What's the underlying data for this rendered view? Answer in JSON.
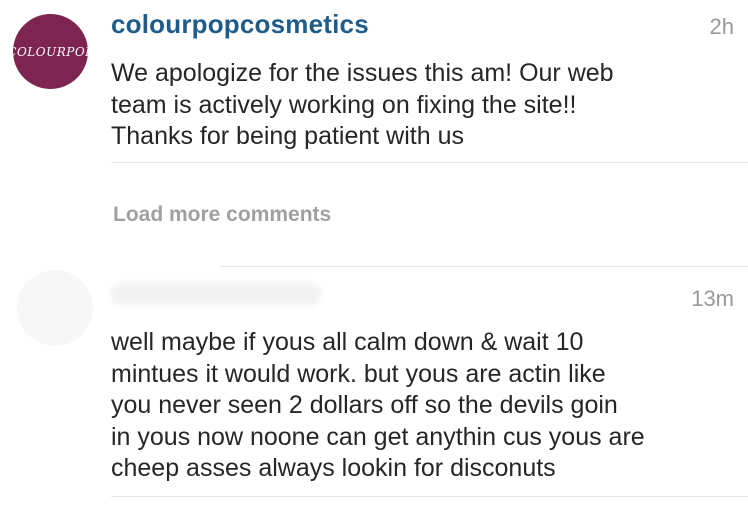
{
  "comments": [
    {
      "avatar_text": "COLOURPOP",
      "username": "colourpopcosmetics",
      "time": "2h",
      "lines": [
        "We apologize for the issues this am! Our web",
        "team is actively working on fixing the site!!",
        "Thanks for being patient with us"
      ]
    },
    {
      "time": "13m",
      "lines": [
        "well maybe if yous all calm down & wait 10",
        "mintues it would work. but yous are actin like",
        "you never seen 2 dollars off so the devils goin",
        "in yous now noone can get anythin cus yous are",
        "cheep asses always lookin for disconuts"
      ]
    }
  ],
  "load_more": "Load more comments",
  "colors": {
    "avatar_bg": "#7d2450",
    "username": "#1f5c8a",
    "muted": "#999999",
    "text": "#262626"
  }
}
